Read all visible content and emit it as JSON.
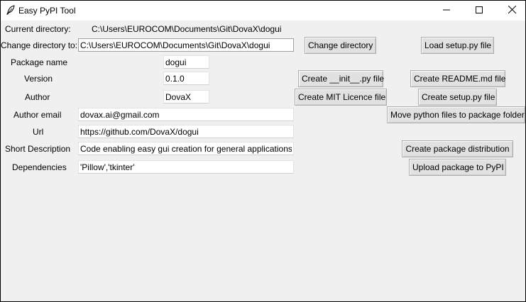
{
  "window": {
    "title": "Easy PyPI Tool",
    "icons": {
      "app": "feather-icon",
      "minimize": "minimize-icon",
      "maximize": "maximize-icon",
      "close": "close-icon"
    }
  },
  "current_directory": {
    "label": "Current directory:",
    "value": "C:\\Users\\EUROCOM\\Documents\\Git\\DovaX\\dogui"
  },
  "change_directory": {
    "label": "Change directory to:",
    "value": "C:\\Users\\EUROCOM\\Documents\\Git\\DovaX\\dogui",
    "button": "Change directory"
  },
  "fields": {
    "package_name": {
      "label": "Package name",
      "value": "dogui"
    },
    "version": {
      "label": "Version",
      "value": "0.1.0"
    },
    "author": {
      "label": "Author",
      "value": "DovaX"
    },
    "author_email": {
      "label": "Author email",
      "value": "dovax.ai@gmail.com"
    },
    "url": {
      "label": "Url",
      "value": "https://github.com/DovaX/dogui"
    },
    "short_description": {
      "label": "Short Description",
      "value": "Code enabling easy gui creation for general applications"
    },
    "dependencies": {
      "label": "Dependencies",
      "value": "'Pillow','tkinter'"
    }
  },
  "buttons": {
    "load_setup": "Load setup.py file",
    "create_init": "Create __init__.py file",
    "create_readme": "Create README.md file",
    "create_licence": "Create MIT Licence file",
    "create_setup": "Create setup.py file",
    "move_files": "Move python files to package folder",
    "create_distribution": "Create package distribution",
    "upload_package": "Upload package to PyPI"
  }
}
